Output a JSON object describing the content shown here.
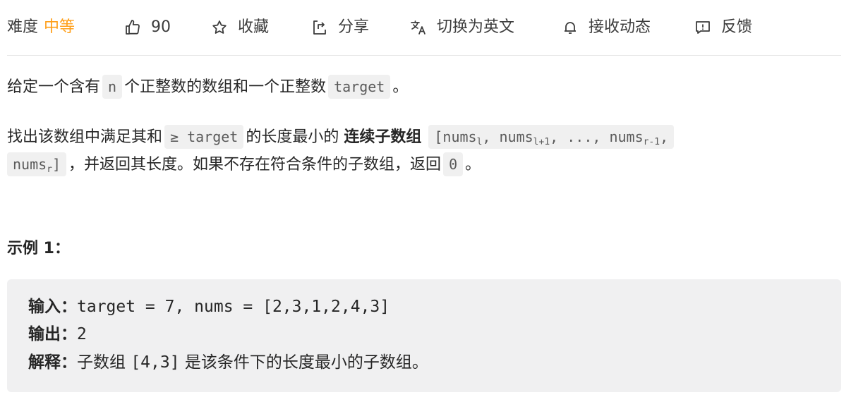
{
  "toolbar": {
    "difficulty_label": "难度",
    "difficulty_value": "中等",
    "difficulty_color": "#ff9f19",
    "like_icon": "thumbs-up-icon",
    "like_count": "90",
    "favorite_icon": "star-icon",
    "favorite_label": "收藏",
    "share_icon": "share-icon",
    "share_label": "分享",
    "translate_icon": "translate-icon",
    "translate_label": "切换为英文",
    "notify_icon": "bell-icon",
    "notify_label": "接收动态",
    "feedback_icon": "feedback-icon",
    "feedback_label": "反馈"
  },
  "description": {
    "p1_text_1": "给定一个含有",
    "p1_code_1": "n",
    "p1_text_2": "个正整数的数组和一个正整数",
    "p1_code_2": "target",
    "p1_text_3": "。",
    "p2_text_1": "找出该数组中满足其和",
    "p2_code_1": "≥ target",
    "p2_text_2": "的长度最小的",
    "p2_strong": "连续子数组",
    "p2_code_2_a": "[nums",
    "p2_code_2_sub_1": "l",
    "p2_code_2_b": ", nums",
    "p2_code_2_sub_2": "l+1",
    "p2_code_2_c": ", ..., nums",
    "p2_code_2_sub_3": "r-1",
    "p2_code_2_d": ",",
    "p2_code_3_a": "nums",
    "p2_code_3_sub": "r",
    "p2_code_3_b": "]",
    "p2_text_3": "，并返回其长度。如果不存在符合条件的子数组，返回",
    "p2_code_4": "0",
    "p2_text_4": "。"
  },
  "example": {
    "title": "示例 1：",
    "input_label": "输入：",
    "input_value": "target = 7, nums = [2,3,1,2,4,3]",
    "output_label": "输出：",
    "output_value": "2",
    "explain_label": "解释：",
    "explain_text_1": "子数组 ",
    "explain_code": "[4,3]",
    "explain_text_2": " 是该条件下的长度最小的子数组。"
  }
}
